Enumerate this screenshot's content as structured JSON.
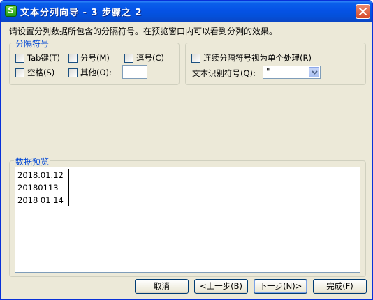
{
  "window": {
    "title": "文本分列向导 - 3 步骤之 2",
    "app_icon_letter": "S"
  },
  "instruction": "请设置分列数据所包含的分隔符号。在预览窗口内可以看到分列的效果。",
  "delimiters": {
    "legend": "分隔符号",
    "tab": {
      "label": "Tab键(T)",
      "checked": false
    },
    "semicolon": {
      "label": "分号(M)",
      "checked": false
    },
    "comma": {
      "label": "逗号(C)",
      "checked": false
    },
    "space": {
      "label": "空格(S)",
      "checked": false
    },
    "other": {
      "label": "其他(O):",
      "checked": false,
      "value": ""
    }
  },
  "options": {
    "consecutive": {
      "label": "连续分隔符号视为单个处理(R)",
      "checked": false
    },
    "text_qualifier_label": "文本识别符号(Q):",
    "text_qualifier_value": "\""
  },
  "preview": {
    "legend": "数据预览",
    "lines": [
      "2018.01.12",
      "20180113",
      "2018 01 14"
    ]
  },
  "buttons": {
    "cancel": "取消",
    "back": "<上一步(B)",
    "next": "下一步(N)>",
    "finish": "完成(F)"
  }
}
